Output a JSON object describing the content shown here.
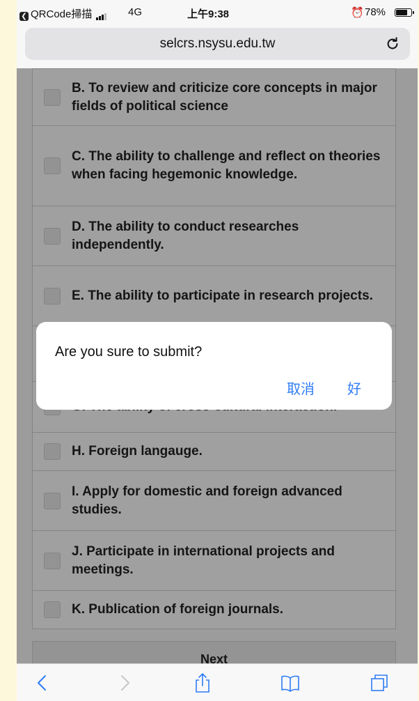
{
  "status_bar": {
    "back_app": "QRCode掃描",
    "network": "4G",
    "time": "上午9:38",
    "battery_percent": "78%",
    "battery_level": 0.78
  },
  "browser": {
    "url": "selcrs.nsysu.edu.tw"
  },
  "options": [
    {
      "label": "B. To review and criticize core concepts in major fields of political science"
    },
    {
      "label": "C. The ability to challenge and reflect on theories when facing hegemonic knowledge."
    },
    {
      "label": "D. The ability to conduct researches independently."
    },
    {
      "label": "E. The ability to participate in research projects."
    },
    {
      "label": "G. The ability of cross-cultural interaction."
    },
    {
      "label": "H. Foreign langauge."
    },
    {
      "label": "I. Apply for domestic and foreign advanced studies."
    },
    {
      "label": "J. Participate in international projects and meetings."
    },
    {
      "label": "K. Publication of foreign journals."
    }
  ],
  "next_button": "Next",
  "dialog": {
    "message": "Are you sure to submit?",
    "cancel_label": "取消",
    "ok_label": "好"
  },
  "colors": {
    "dialog_button": "#2f7cf6",
    "toolbar_icon": "#2f7cf6"
  },
  "toolbar": {
    "icons": [
      "back-icon",
      "forward-icon",
      "share-icon",
      "bookmarks-icon",
      "tabs-icon"
    ]
  }
}
